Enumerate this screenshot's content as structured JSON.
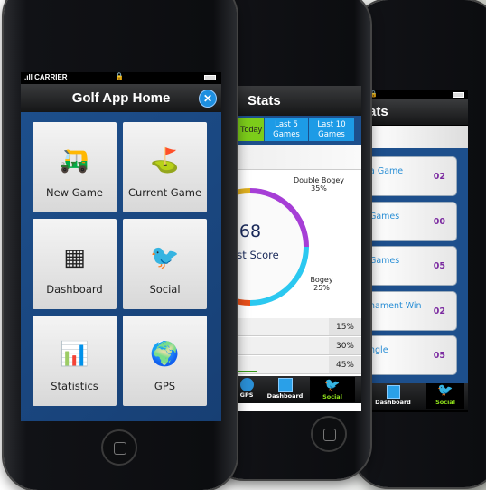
{
  "phone_home": {
    "status": {
      "carrier": "CARRIER",
      "signal_icon": "signal-bars",
      "lock_icon": "lock",
      "battery_icon": "battery"
    },
    "title": "Golf App Home",
    "settings_icon": "tools-icon",
    "tiles": [
      {
        "label": "New Game",
        "icon": "golf-cart"
      },
      {
        "label": "Current Game",
        "icon": "flag-green"
      },
      {
        "label": "Dashboard",
        "icon": "grid"
      },
      {
        "label": "Social",
        "icon": "twitter-bird"
      },
      {
        "label": "Statistics",
        "icon": "bar-chart"
      },
      {
        "label": "GPS",
        "icon": "globe"
      }
    ]
  },
  "phone_stats": {
    "title": "Stats",
    "tabs": [
      {
        "label": "Today",
        "visible": "oday",
        "active": true
      },
      {
        "label": "Last 5 Games"
      },
      {
        "label": "Last 10 Games"
      }
    ],
    "score": "68",
    "score_label": "Best Score",
    "segments": [
      {
        "label": "Double Bogey",
        "pct": "35%",
        "color": "#a63ed6"
      },
      {
        "label": "Bogey",
        "pct": "25%",
        "color": "#2bc8f0"
      }
    ],
    "rows": [
      "15%",
      "30%",
      "45%"
    ],
    "tabbar": [
      {
        "label": "GPS"
      },
      {
        "label": "Dashboard"
      },
      {
        "label": "Social",
        "active": true
      }
    ]
  },
  "phone_list": {
    "title": "ats",
    "cards": [
      {
        "label": "a Game",
        "value": "02"
      },
      {
        "label": "Games",
        "value": "00"
      },
      {
        "label": "Games",
        "value": "05"
      },
      {
        "label": "nament Win",
        "value": "02"
      },
      {
        "label": "ngle",
        "value": "05"
      }
    ],
    "tabbar": [
      {
        "label": "Dashboard"
      },
      {
        "label": "Social",
        "active": true
      }
    ]
  },
  "colors": {
    "blue_bg": "#1d4f8c",
    "tab_blue": "#1d9be6",
    "tab_green": "#7ccc1a",
    "social_green": "#8fe01a"
  }
}
